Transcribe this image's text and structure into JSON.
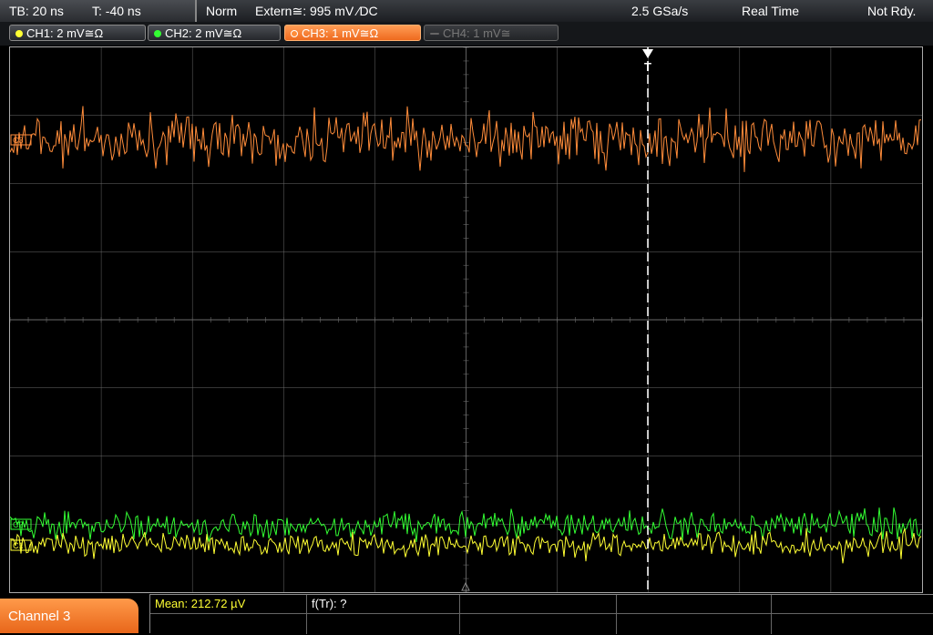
{
  "status_bar": {
    "timebase": "TB: 20 ns",
    "trigger_time": "T: -40 ns",
    "acq_mode": "Norm",
    "trigger_info": "Extern≅: 995 mV ⁄DC",
    "sample_rate": "2.5 GSa/s",
    "acq_type": "Real Time",
    "status": "Not Rdy."
  },
  "channels": [
    {
      "label": "CH1: 2 mV≅Ω",
      "color": "#ffff33",
      "active": true
    },
    {
      "label": "CH2: 2 mV≅Ω",
      "color": "#33ff33",
      "active": true
    },
    {
      "label": "CH3: 1 mV≅Ω",
      "color": "#ff8c3a",
      "active": true,
      "selected": true
    },
    {
      "label": "CH4: 1 mV≅",
      "color": "#666666",
      "active": false
    }
  ],
  "trigger_marker": "T",
  "ch_markers": {
    "ch3": "C3",
    "ch2": "C2",
    "ch1": "C1"
  },
  "bottom": {
    "channel_label": "Channel 3",
    "mean": "Mean: 212.72 µV",
    "frequency": "f(Tr): ?"
  },
  "colors": {
    "ch1": "#ffff33",
    "ch2": "#33ff33",
    "ch3": "#ff8c3a",
    "grid": "#6a6a6a",
    "mean_text": "#ffff33"
  }
}
